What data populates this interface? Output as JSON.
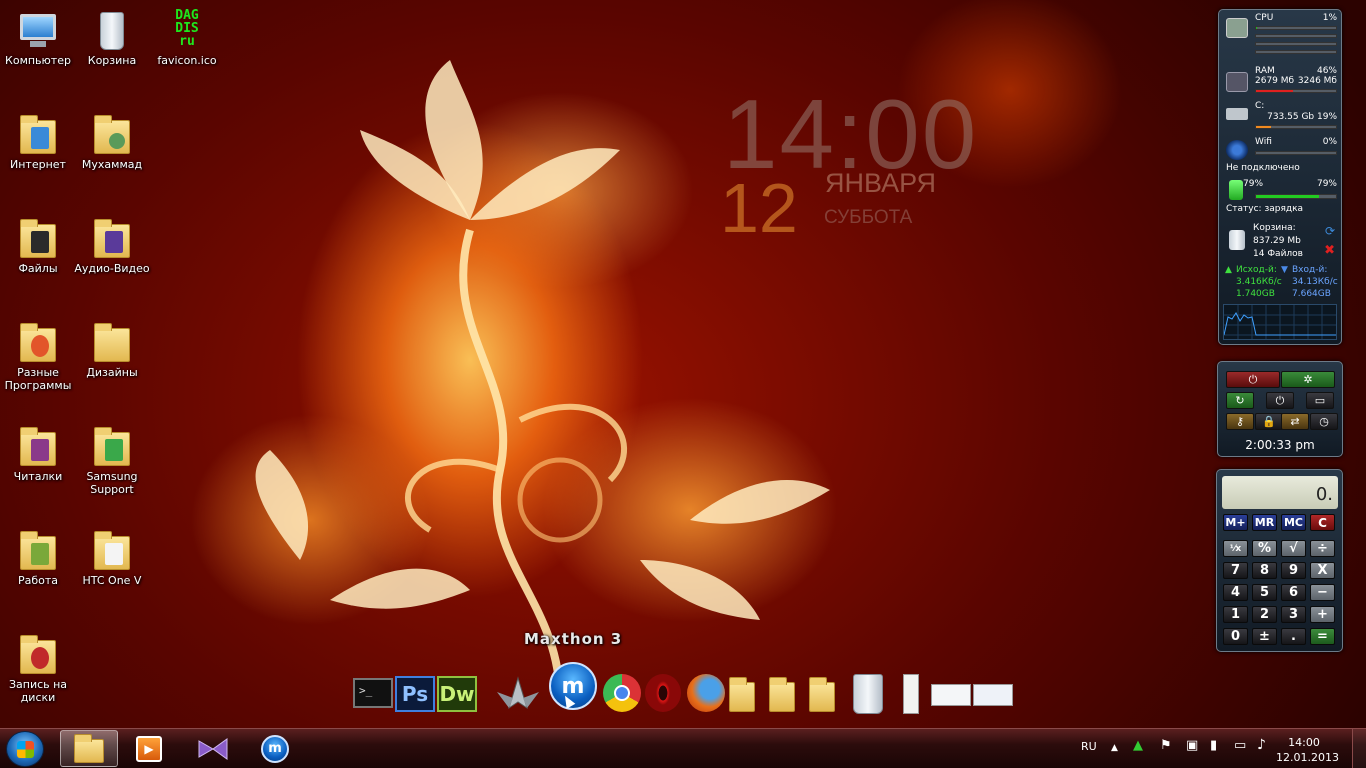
{
  "desktop": {
    "icons": [
      {
        "label": "Компьютер"
      },
      {
        "label": "Корзина"
      },
      {
        "label": "favicon.ico",
        "art_text": "DAG DIS ru"
      },
      {
        "label": "Интернет"
      },
      {
        "label": "Мухаммад"
      },
      {
        "label": "Файлы"
      },
      {
        "label": "Аудио-Видео"
      },
      {
        "label": "Разные Программы"
      },
      {
        "label": "Дизайны"
      },
      {
        "label": "Читалки"
      },
      {
        "label": "Samsung Support"
      },
      {
        "label": "Работа"
      },
      {
        "label": "HTC One V"
      },
      {
        "label": "Запись на диски"
      }
    ]
  },
  "clock_widget": {
    "time": "14:00",
    "day": "12",
    "month": "ЯНВАРЯ",
    "weekday": "СУББОТА"
  },
  "monitor": {
    "cpu": {
      "label": "CPU",
      "value": "1%",
      "levels": [
        0.01,
        0.0,
        0.0,
        0.0
      ]
    },
    "ram": {
      "label": "RAM",
      "percent": "46%",
      "used": "2679 Мб",
      "total": "3246 Мб",
      "level": 0.46
    },
    "disk": {
      "label": "C:",
      "info": "733.55 Gb 19%",
      "level": 0.19
    },
    "wifi": {
      "label": "Wifi",
      "value": "0%",
      "status": "Не подключено",
      "level": 0.0
    },
    "battery": {
      "value_left": "79%",
      "value_right": "79%",
      "status": "Статус: зарядка",
      "level": 0.79
    },
    "recycle": {
      "label": "Корзина:",
      "size": "837.29 Mb",
      "files": "14 Файлов"
    },
    "network": {
      "out_label": "Исход-й:",
      "out_speed": "3.416Кб/с",
      "out_total": "1.740GB",
      "in_label": "Вход-й:",
      "in_speed": "34.13Кб/с",
      "in_total": "7.664GB"
    }
  },
  "shutdown_gadget": {
    "time": "2:00:33 pm"
  },
  "calculator": {
    "display": "0.",
    "memory_keys": [
      "M+",
      "MR",
      "MC",
      "C"
    ],
    "keys": [
      [
        "⅟x",
        "%",
        "√",
        "÷"
      ],
      [
        "7",
        "8",
        "9",
        "X"
      ],
      [
        "4",
        "5",
        "6",
        "−"
      ],
      [
        "1",
        "2",
        "3",
        "+"
      ],
      [
        "0",
        "±",
        ".",
        "="
      ]
    ]
  },
  "dock": {
    "tooltip": "Maxthon 3",
    "ps_label": "Ps",
    "dw_label": "Dw",
    "console_label": ">_"
  },
  "taskbar": {
    "lang": "RU",
    "time": "14:00",
    "date": "12.01.2013"
  },
  "colors": {
    "accent_green": "#1fb81f",
    "ram_bar": "#e02020",
    "disk_bar": "#f08a20",
    "battery_bar": "#22cc22"
  }
}
